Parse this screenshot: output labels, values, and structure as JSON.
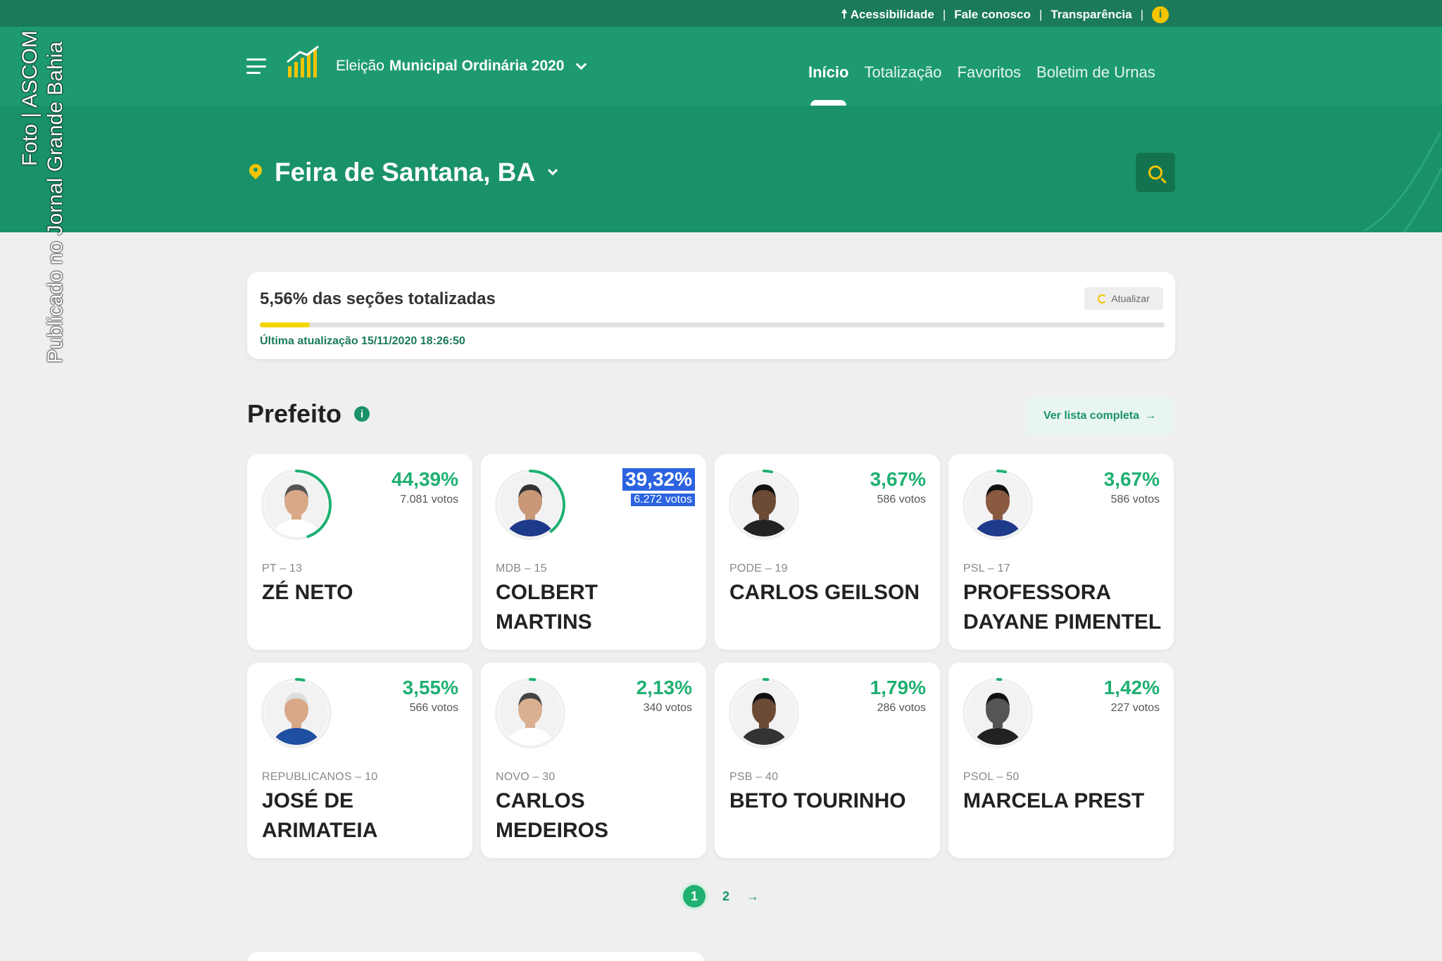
{
  "topbar": {
    "links": [
      "Acessibilidade",
      "Fale conosco",
      "Transparência"
    ],
    "separator": "|",
    "info_glyph": "i"
  },
  "nav": {
    "election_prefix": "Eleição",
    "election_title": "Municipal Ordinária 2020",
    "menu": [
      {
        "label": "Início",
        "active": true
      },
      {
        "label": "Totalização",
        "active": false
      },
      {
        "label": "Favoritos",
        "active": false
      },
      {
        "label": "Boletim de Urnas",
        "active": false
      }
    ]
  },
  "location": {
    "label": "Feira de Santana, BA"
  },
  "credit": {
    "line1": "Foto | ASCOM",
    "line2": "Publicado no Jornal Grande Bahia"
  },
  "progress": {
    "title": "5,56% das seções totalizadas",
    "fraction": 0.0556,
    "refresh_label": "Atualizar",
    "last_update": "Última atualização 15/11/2020 18:26:50"
  },
  "section": {
    "title": "Prefeito",
    "info_glyph": "i",
    "link_label": "Ver lista completa",
    "link_arrow": "→"
  },
  "candidates": [
    {
      "pct": "44,39%",
      "votes": "7.081 votos",
      "party": "PT – 13",
      "name": "ZÉ NETO",
      "share": 0.4439
    },
    {
      "pct": "39,32%",
      "votes": "6.272 votos",
      "party": "MDB – 15",
      "name": "COLBERT MARTINS",
      "share": 0.3932
    },
    {
      "pct": "3,67%",
      "votes": "586 votos",
      "party": "PODE – 19",
      "name": "CARLOS GEILSON",
      "share": 0.0367
    },
    {
      "pct": "3,67%",
      "votes": "586 votos",
      "party": "PSL – 17",
      "name": "PROFESSORA DAYANE PIMENTEL",
      "share": 0.0367
    },
    {
      "pct": "3,55%",
      "votes": "566 votos",
      "party": "REPUBLICANOS – 10",
      "name": "JOSÉ DE ARIMATEIA",
      "share": 0.0355
    },
    {
      "pct": "2,13%",
      "votes": "340 votos",
      "party": "NOVO – 30",
      "name": "CARLOS MEDEIROS",
      "share": 0.0213
    },
    {
      "pct": "1,79%",
      "votes": "286 votos",
      "party": "PSB – 40",
      "name": "BETO TOURINHO",
      "share": 0.0179
    },
    {
      "pct": "1,42%",
      "votes": "227 votos",
      "party": "PSOL – 50",
      "name": "MARCELA PREST",
      "share": 0.0142
    }
  ],
  "pager": {
    "pages": [
      "1",
      "2"
    ],
    "current": "1",
    "next": "→"
  },
  "colors": {
    "primary_green": "#1a9269",
    "accent_yellow": "#f5c400",
    "pct_green": "#1fb071",
    "highlight_blue": "#2b63e0"
  },
  "icons": [
    "menu-icon",
    "bar-chart-logo-icon",
    "chevron-down-icon",
    "location-pin-icon",
    "search-icon",
    "refresh-icon",
    "info-icon",
    "arrow-right-icon",
    "accessibility-icon"
  ]
}
